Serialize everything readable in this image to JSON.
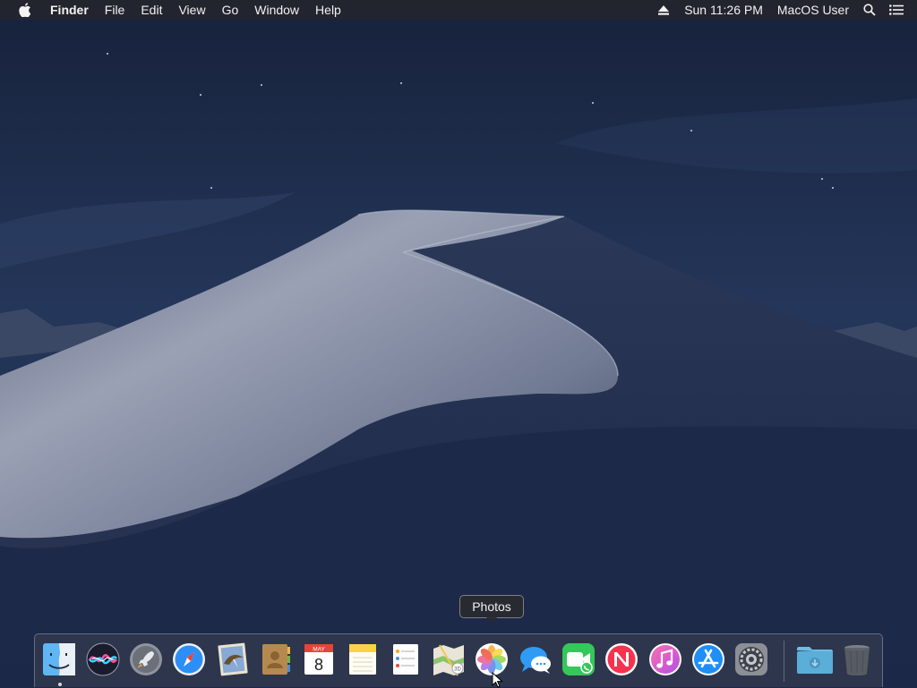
{
  "menubar": {
    "apple_icon": "apple-logo-icon",
    "app_name": "Finder",
    "menus": [
      "File",
      "Edit",
      "View",
      "Go",
      "Window",
      "Help"
    ],
    "clock": "Sun 11:26 PM",
    "user": "MacOS User",
    "status_icons": [
      "eject-icon",
      "spotlight-search-icon",
      "notification-center-icon"
    ]
  },
  "dock": {
    "tooltip": "Photos",
    "apps": [
      {
        "icon": "finder-icon",
        "running": true
      },
      {
        "icon": "siri-icon"
      },
      {
        "icon": "launchpad-icon"
      },
      {
        "icon": "safari-icon"
      },
      {
        "icon": "mail-icon"
      },
      {
        "icon": "contacts-icon"
      },
      {
        "icon": "calendar-icon",
        "month": "MAY",
        "day": "8"
      },
      {
        "icon": "notes-icon"
      },
      {
        "icon": "reminders-icon"
      },
      {
        "icon": "maps-icon"
      },
      {
        "icon": "photos-icon"
      },
      {
        "icon": "messages-icon"
      },
      {
        "icon": "facetime-icon"
      },
      {
        "icon": "news-icon"
      },
      {
        "icon": "itunes-icon"
      },
      {
        "icon": "app-store-icon"
      },
      {
        "icon": "system-preferences-icon"
      },
      {
        "icon": "downloads-folder-icon"
      },
      {
        "icon": "trash-icon"
      }
    ]
  },
  "colors": {
    "sky_top": "#17223b",
    "sky_bottom": "#2c3d5e",
    "dune_light": "#8b93a8",
    "dune_dark": "#1d2a4b"
  }
}
